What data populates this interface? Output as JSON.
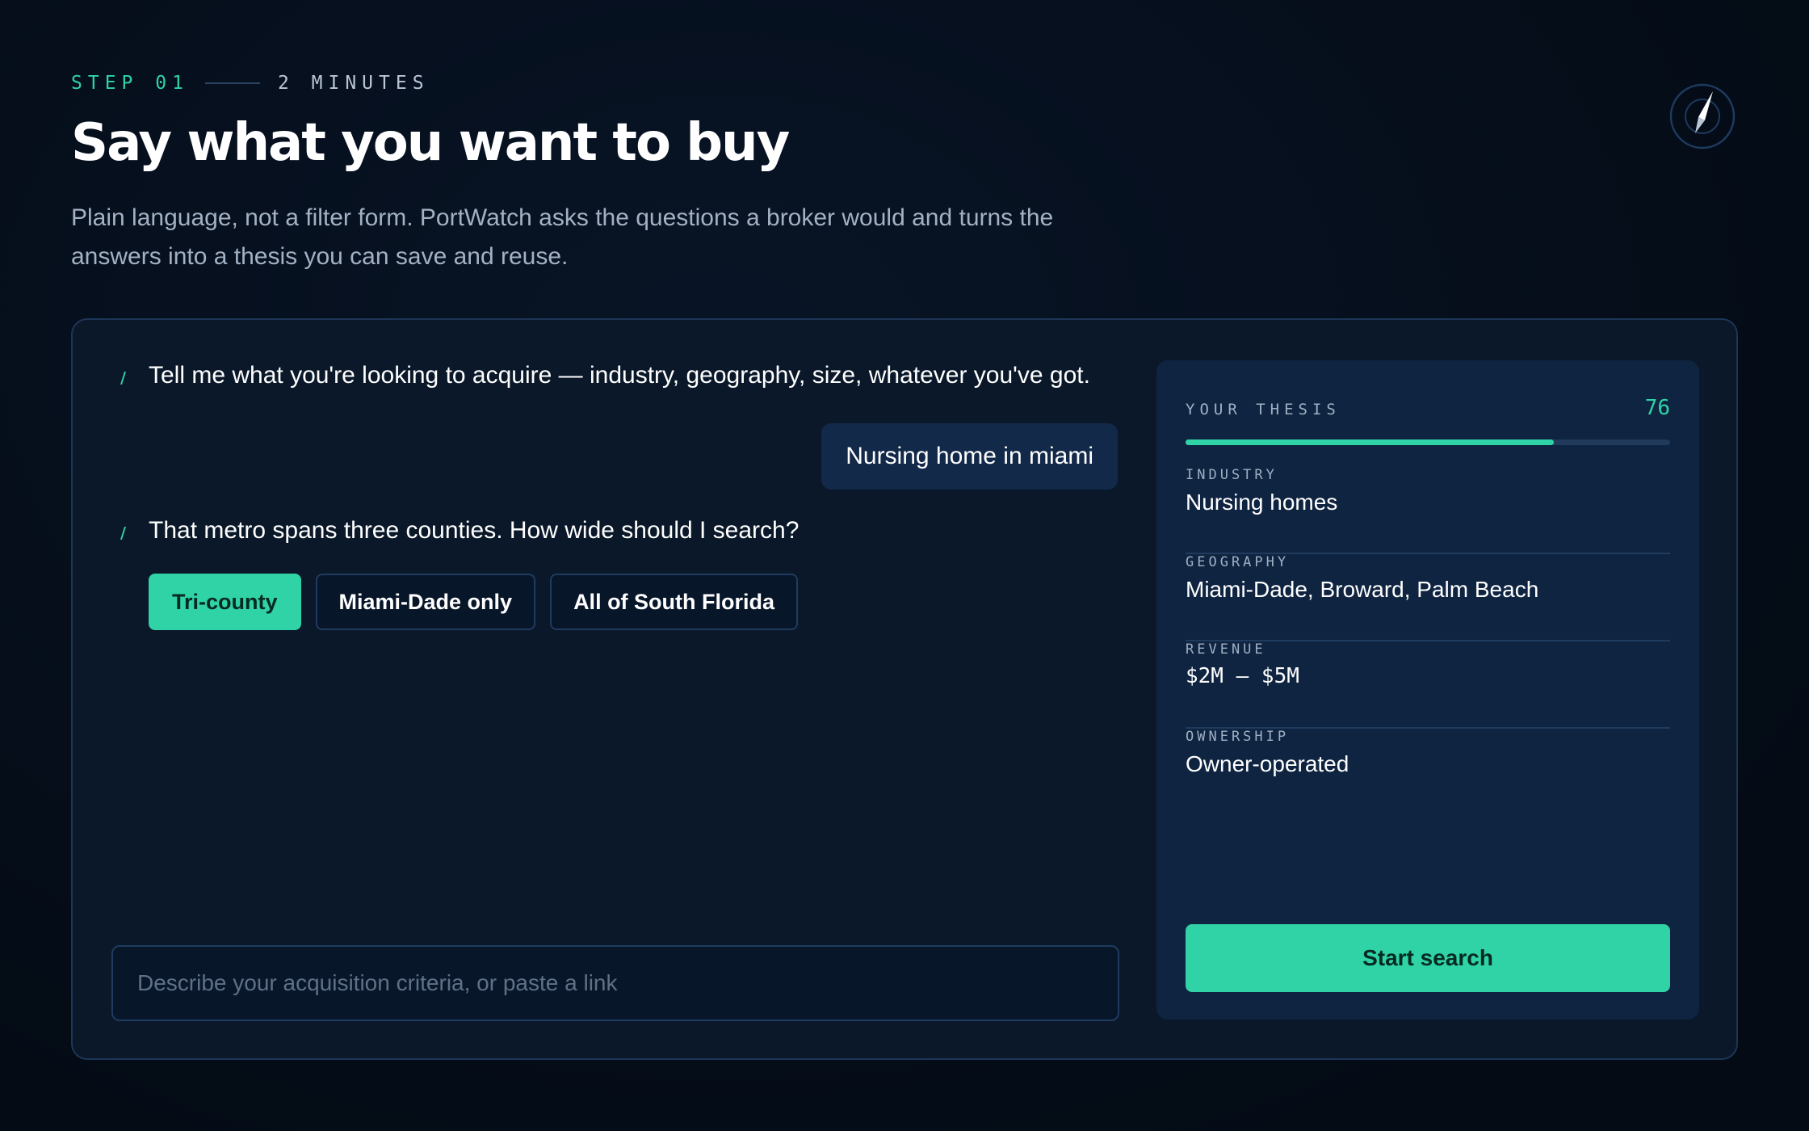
{
  "header": {
    "step": "STEP 01",
    "time": "2 MINUTES",
    "title": "Say what you want to buy",
    "subtitle_line1": "Plain language, not a filter form. PortWatch asks the questions a broker would and turns the",
    "subtitle_line2": "answers into a thesis you can save and reuse."
  },
  "chat": {
    "assistant_message_1": "Tell me what you're looking to acquire — industry, geography, size, whatever you've got.",
    "user_message": "Nursing home in miami",
    "assistant_message_2": "That metro spans three counties. How wide should I search?",
    "options": [
      {
        "label": "Tri-county",
        "selected": true
      },
      {
        "label": "Miami-Dade only",
        "selected": false
      },
      {
        "label": "All of South Florida",
        "selected": false
      }
    ],
    "input_placeholder": "Describe your acquisition criteria, or paste a link"
  },
  "thesis": {
    "label": "YOUR THESIS",
    "score": "76",
    "progress_fraction": 0.76,
    "fields": [
      {
        "label": "INDUSTRY",
        "value": "Nursing homes"
      },
      {
        "label": "GEOGRAPHY",
        "value": "Miami-Dade, Broward, Palm Beach"
      },
      {
        "label": "REVENUE",
        "value": "$2M – $5M"
      },
      {
        "label": "OWNERSHIP",
        "value": "Owner-operated"
      }
    ],
    "start_button": "Start search"
  },
  "colors": {
    "accent": "#2fd3a6",
    "background": "#050e1a",
    "card": "#0a1829",
    "panel": "#0f2441"
  },
  "icons": {
    "corner": "compass-icon",
    "assistant_marker": "assistant-marker-icon"
  }
}
